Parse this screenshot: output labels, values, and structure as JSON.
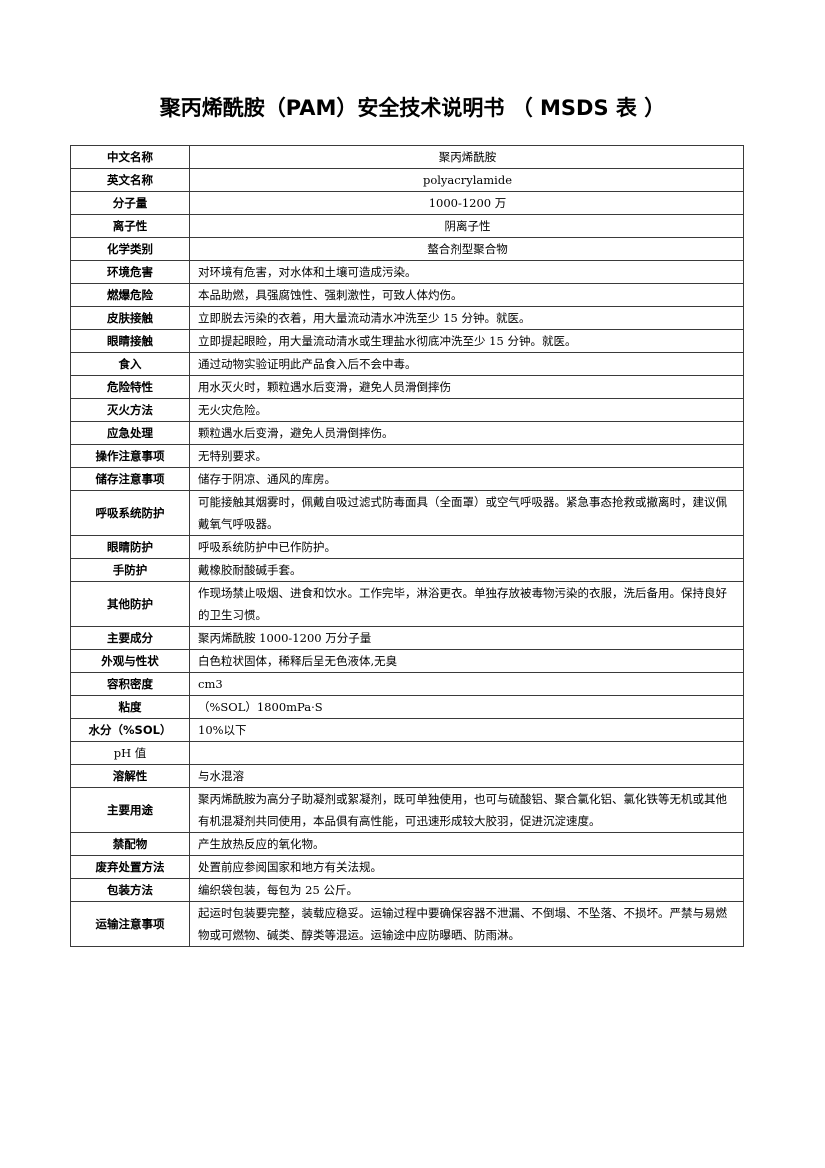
{
  "document": {
    "title": "聚丙烯酰胺（PAM）安全技术说明书 （  MSDS 表  ）"
  },
  "table": {
    "rows": [
      {
        "label": "中文名称",
        "value": "聚丙烯酰胺",
        "align": "center"
      },
      {
        "label": "英文名称",
        "value": "polyacrylamide",
        "align": "center"
      },
      {
        "label": "分子量",
        "value": "1000-1200 万",
        "align": "center"
      },
      {
        "label": "离子性",
        "value": "阴离子性",
        "align": "center"
      },
      {
        "label": "化学类别",
        "value": "螯合剂型聚合物",
        "align": "center"
      },
      {
        "label": "环境危害",
        "value": "对环境有危害，对水体和土壤可造成污染。"
      },
      {
        "label": "燃爆危险",
        "value": "本品助燃，具强腐蚀性、强刺激性，可致人体灼伤。"
      },
      {
        "label": "皮肤接触",
        "value": "立即脱去污染的衣着，用大量流动清水冲洗至少 15 分钟。就医。"
      },
      {
        "label": "眼睛接触",
        "value": "立即提起眼睑，用大量流动清水或生理盐水彻底冲洗至少 15 分钟。就医。"
      },
      {
        "label": "食入",
        "value": "通过动物实验证明此产品食入后不会中毒。"
      },
      {
        "label": "危险特性",
        "value": "用水灭火时，颗粒遇水后变滑，避免人员滑倒摔伤"
      },
      {
        "label": "灭火方法",
        "value": "无火灾危险。"
      },
      {
        "label": "应急处理",
        "value": "颗粒遇水后变滑，避免人员滑倒摔伤。"
      },
      {
        "label": "操作注意事项",
        "value": "无特别要求。"
      },
      {
        "label": "储存注意事项",
        "value": "储存于阴凉、通风的库房。"
      },
      {
        "label": "呼吸系统防护",
        "value": "可能接触其烟雾时，佩戴自吸过滤式防毒面具（全面罩）或空气呼吸器。紧急事态抢救或撤离时，建议佩戴氧气呼吸器。",
        "tall": true
      },
      {
        "label": "眼睛防护",
        "value": "呼吸系统防护中已作防护。"
      },
      {
        "label": "手防护",
        "value": "戴橡胶耐酸碱手套。"
      },
      {
        "label": "其他防护",
        "value": "作现场禁止吸烟、进食和饮水。工作完毕，淋浴更衣。单独存放被毒物污染的衣服，洗后备用。保持良好的卫生习惯。",
        "tall": true
      },
      {
        "label": "主要成分",
        "value": "聚丙烯酰胺 1000-1200 万分子量"
      },
      {
        "label": "外观与性状",
        "value": "白色粒状固体，稀释后呈无色液体,无臭"
      },
      {
        "label": "容积密度",
        "value": "cm3"
      },
      {
        "label": "粘度",
        "value": "（%SOL）1800mPa·S"
      },
      {
        "label": "水分（%SOL）",
        "value": "10%以下"
      },
      {
        "label": "pH 值",
        "value": "",
        "plain": true
      },
      {
        "label": "溶解性",
        "value": "与水混溶"
      },
      {
        "label": "主要用途",
        "value": "聚丙烯酰胺为高分子助凝剂或絮凝剂，既可单独使用，也可与硫酸铝、聚合氯化铝、氯化铁等无机或其他有机混凝剂共同使用，本品俱有高性能，可迅速形成较大胶羽，促进沉淀速度。",
        "tall": true
      },
      {
        "label": "禁配物",
        "value": "产生放热反应的氧化物。"
      },
      {
        "label": "废弃处置方法",
        "value": "处置前应参阅国家和地方有关法规。"
      },
      {
        "label": "包装方法",
        "value": "编织袋包装，每包为 25 公斤。"
      },
      {
        "label": "运输注意事项",
        "value": "起运时包装要完整，装载应稳妥。运输过程中要确保容器不泄漏、不倒塌、不坠落、不损坏。严禁与易燃物或可燃物、碱类、醇类等混运。运输途中应防曝晒、防雨淋。",
        "tall": true
      }
    ]
  }
}
